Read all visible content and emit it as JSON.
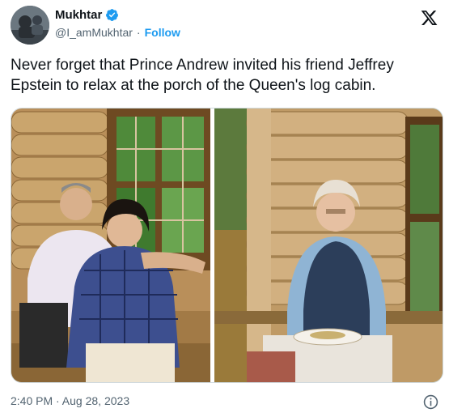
{
  "author": {
    "name": "Mukhtar",
    "handle": "@I_amMukhtar",
    "separator": "·",
    "follow_label": "Follow"
  },
  "tweet": {
    "text": "Never forget that Prince Andrew invited his friend Jeffrey Epstein to relax at the porch of the Queen's log cabin."
  },
  "meta": {
    "timestamp": "2:40 PM · Aug 28, 2023"
  },
  "icons": {
    "verified": "verified-badge-icon",
    "platform": "x-logo-icon",
    "info": "info-icon"
  },
  "colors": {
    "accent": "#1d9bf0",
    "text": "#0f1419",
    "secondary": "#536471"
  }
}
